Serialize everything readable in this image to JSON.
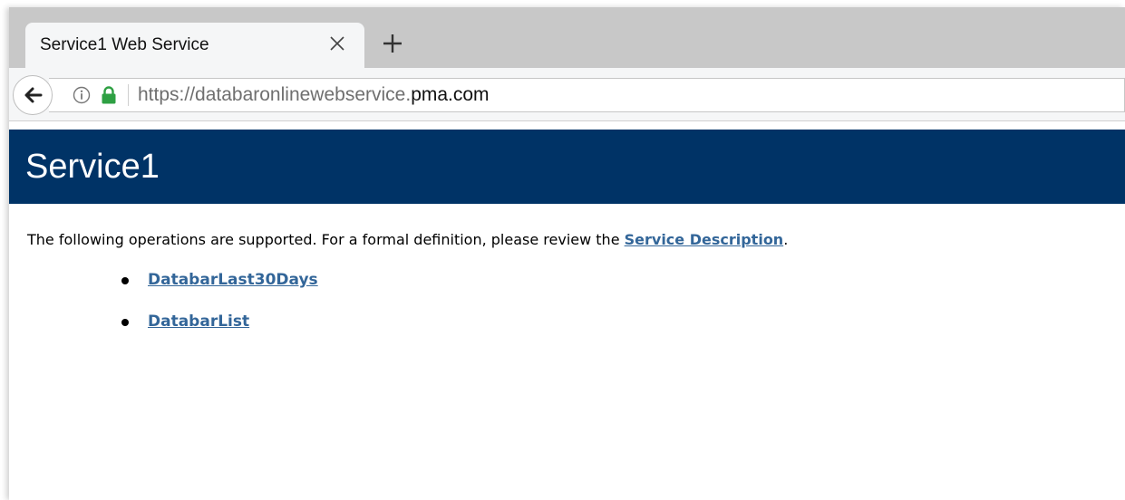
{
  "browser": {
    "tab_title": "Service1 Web Service",
    "url_prefix": "https://databaronlinewebservice.",
    "url_domain": "pma.com"
  },
  "icons": {
    "tab_close": "close-icon",
    "new_tab": "plus-icon",
    "back": "back-arrow-icon",
    "info": "info-icon",
    "lock": "lock-icon"
  },
  "colors": {
    "heading_band": "#003366",
    "link": "#336699",
    "lock": "#2ea043"
  },
  "page": {
    "title": "Service1",
    "intro_text": "The following operations are supported. For a formal definition, please review the ",
    "service_description_link": "Service Description",
    "intro_end": ".",
    "operations": [
      {
        "name": "DatabarLast30Days"
      },
      {
        "name": "DatabarList"
      }
    ]
  }
}
